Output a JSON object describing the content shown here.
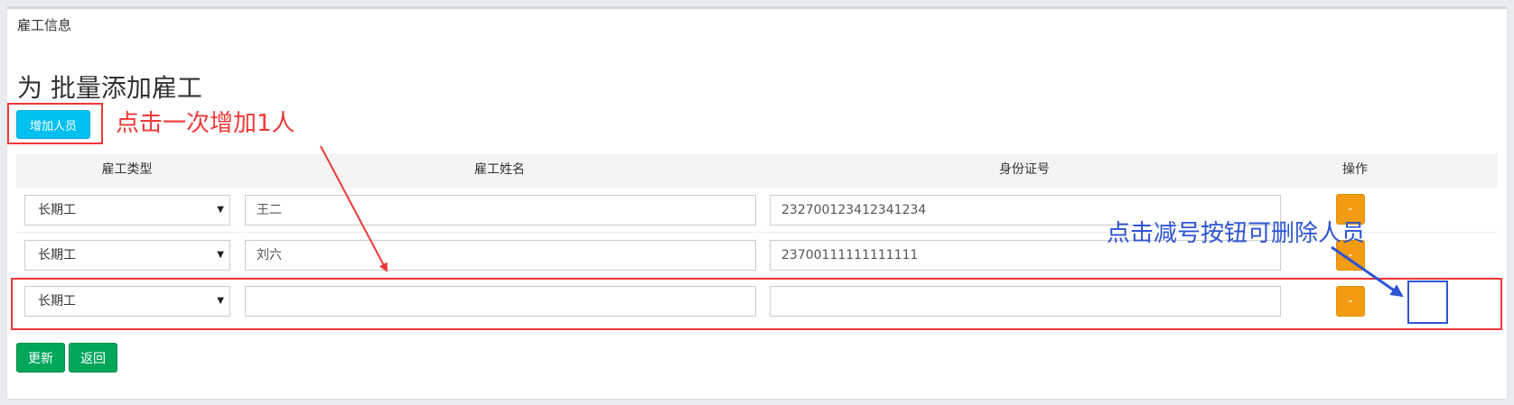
{
  "panel": {
    "title": "雇工信息"
  },
  "heading": "为 批量添加雇工",
  "add_button": "增加人员",
  "annotations": {
    "add_hint": "点击一次增加1人",
    "delete_hint": "点击减号按钮可删除人员",
    "red_color": "#f03838",
    "blue_color": "#2d55d4"
  },
  "table": {
    "headers": [
      "雇工类型",
      "雇工姓名",
      "身份证号",
      "操作"
    ],
    "rows": [
      {
        "type": "长期工",
        "name": "王二",
        "id_number": "232700123412341234",
        "action": "-"
      },
      {
        "type": "长期工",
        "name": "刘六",
        "id_number": "23700111111111111",
        "action": "-"
      },
      {
        "type": "长期工",
        "name": "",
        "id_number": "",
        "action": "-"
      }
    ]
  },
  "footer": {
    "update_label": "更新",
    "back_label": "返回"
  },
  "colors": {
    "info": "#00c0ef",
    "warning": "#f39c12",
    "success": "#00a65a"
  }
}
